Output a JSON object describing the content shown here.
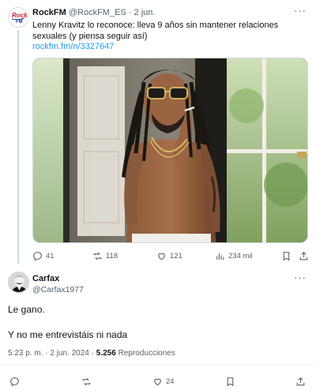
{
  "parent_tweet": {
    "author_name": "RockFM",
    "handle": "@RockFM_ES",
    "separator": "·",
    "date": "2 jun.",
    "text": "Lenny Kravitz lo reconoce: lleva 9 años sin mantener relaciones sexuales (y piensa seguir así)",
    "link": "rockfm.fm/n/3327647",
    "avatar_logo_text": "Rock FM",
    "more_icon": "more-icon",
    "media_icon": "photo",
    "stats": {
      "replies": "41",
      "retweets": "118",
      "likes": "121",
      "views": "234 mil"
    },
    "icons": [
      "reply-icon",
      "retweet-icon",
      "like-icon",
      "views-icon",
      "bookmark-icon",
      "share-icon"
    ]
  },
  "reply_tweet": {
    "author_name": "Carfax",
    "handle": "@Carfax1977",
    "line1": "Le gano.",
    "line2": "Y no me entrevistáis ni nada",
    "time": "5:23 p. m.",
    "separator1": "·",
    "date": "2 jun. 2024",
    "separator2": "·",
    "views_count": "5.256",
    "views_label": "Reproducciones",
    "stats": {
      "likes": "24"
    },
    "icons": [
      "reply-icon",
      "retweet-icon",
      "like-icon",
      "bookmark-icon",
      "share-icon"
    ]
  },
  "colors": {
    "link": "#1d9bf0",
    "muted": "#536471",
    "text": "#0f1419",
    "rockfm_red": "#d81e2a",
    "rockfm_blue": "#1b3c8f"
  }
}
